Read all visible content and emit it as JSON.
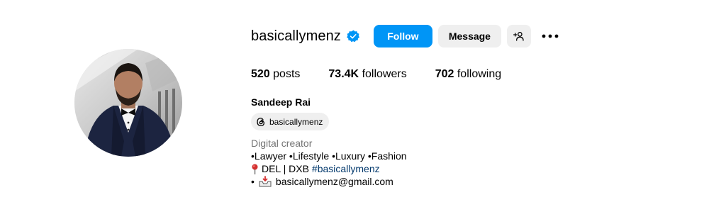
{
  "profile": {
    "username": "basicallymenz",
    "full_name": "Sandeep Rai",
    "follow_label": "Follow",
    "message_label": "Message",
    "icons": {
      "verified": "verified-badge-icon",
      "add_person": "add-person-icon",
      "more": "more-options-icon",
      "threads": "threads-icon",
      "pin": "round-pushpin-icon",
      "mail": "inbox-tray-icon"
    }
  },
  "stats": {
    "posts_count": "520",
    "posts_label": "posts",
    "followers_count": "73.4K",
    "followers_label": "followers",
    "following_count": "702",
    "following_label": "following"
  },
  "threads_chip": {
    "label": "basicallymenz"
  },
  "bio": {
    "category": "Digital creator",
    "line1": "•Lawyer •Lifestyle •Luxury •Fashion",
    "line2_text": "DEL | DXB",
    "line2_hashtag": "#basicallymenz",
    "line3_bullet": "•",
    "line3_email": "basicallymenz@gmail.com"
  },
  "colors": {
    "follow_button": "#0095f6",
    "secondary_button": "#efefef",
    "verified": "#0095f6",
    "hashtag": "#00376b",
    "category_text": "#737373"
  }
}
